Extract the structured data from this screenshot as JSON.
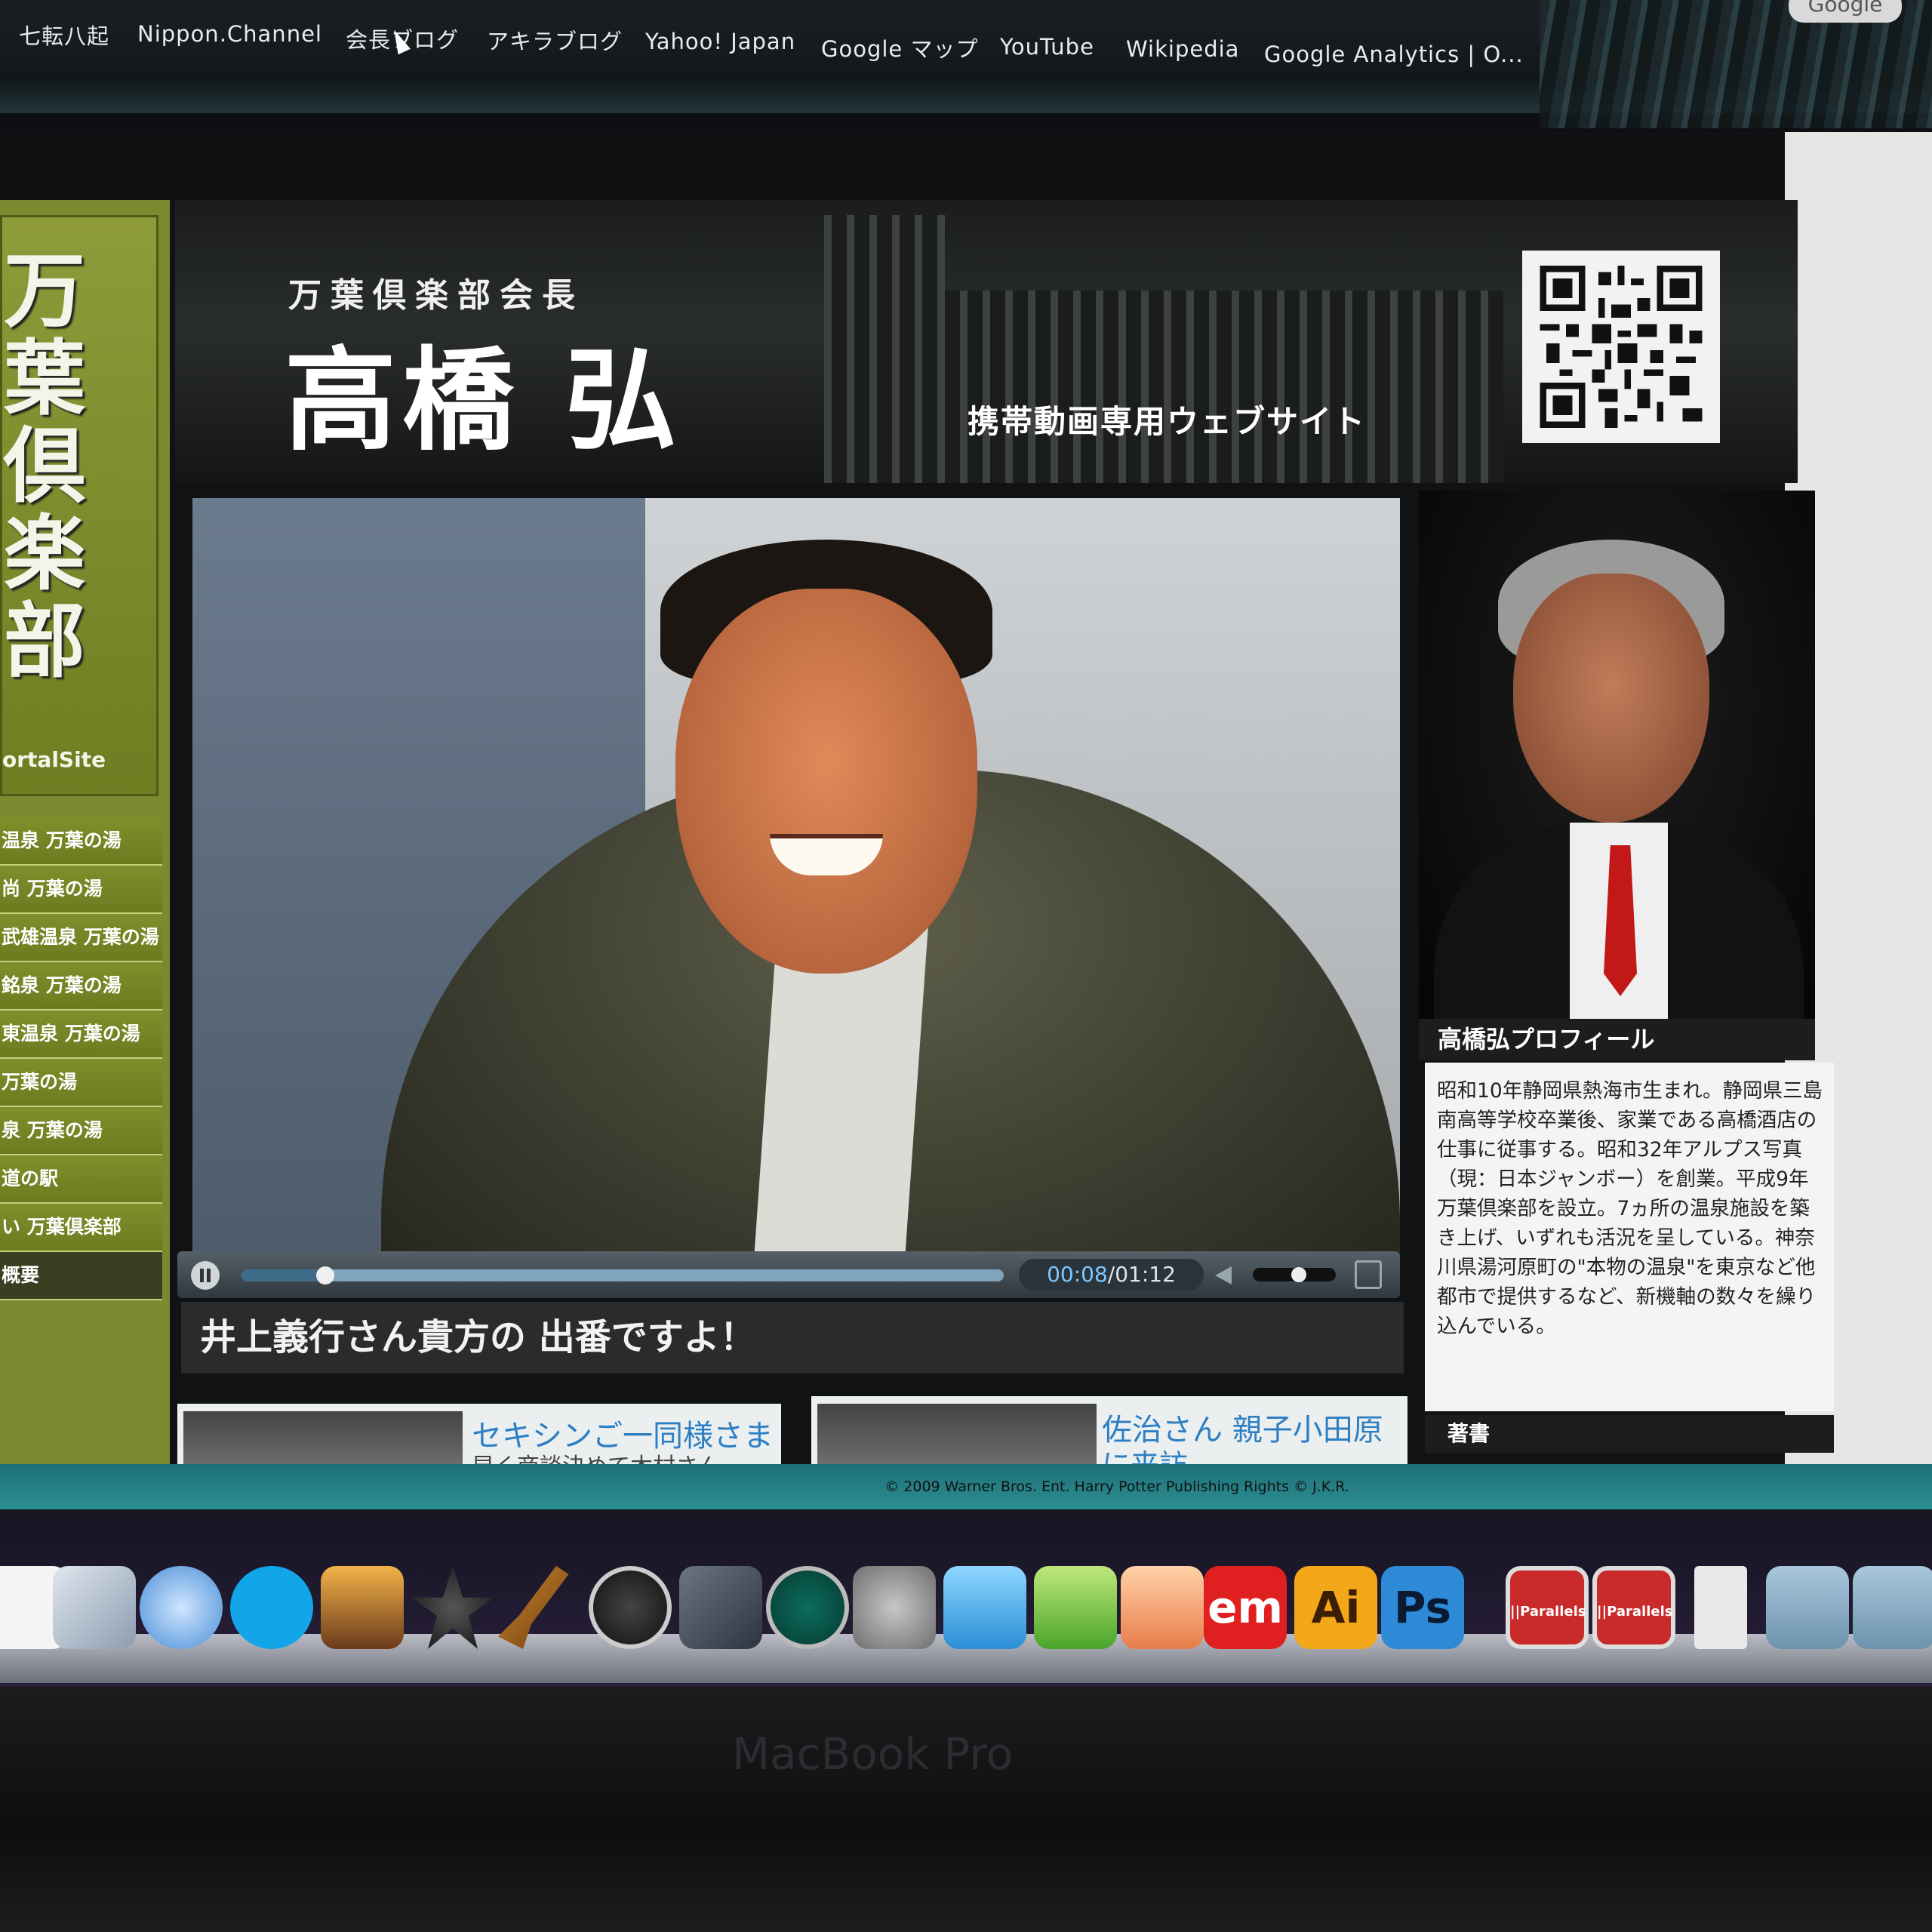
{
  "browser": {
    "bookmarks": [
      "七転八起",
      "Nippon.Channel",
      "会長ブログ",
      "アキラブログ",
      "Yahoo! Japan",
      "Google マップ",
      "YouTube",
      "Wikipedia",
      "Google Analytics | O..."
    ],
    "search_engine_label": "Google"
  },
  "sidebar": {
    "logo_text": "万葉倶楽部",
    "logo_sub": "ortalSite",
    "items": [
      "温泉 万葉の湯",
      "尚 万葉の湯",
      "武雄温泉 万葉の湯",
      "銘泉 万葉の湯",
      "東温泉 万葉の湯",
      "万葉の湯",
      "泉 万葉の湯",
      "道の駅",
      "い 万葉倶楽部",
      "概要"
    ]
  },
  "header": {
    "subtitle": "万葉倶楽部会長",
    "name": "高橋 弘",
    "tagline": "携帯動画専用ウェブサイト"
  },
  "video": {
    "time_current": "00:08",
    "time_total": "01:12",
    "time_separator": "/",
    "progress": 0.11,
    "volume": 0.55,
    "caption": "井上義行さん貴方の 出番ですよ！"
  },
  "thumbnails": [
    {
      "title": "セキシンご一同様さま",
      "sub": "早く商談決めて木村さん"
    },
    {
      "title": "佐治さん 親子小田原",
      "sub": "に来訪"
    }
  ],
  "profile": {
    "heading": "高橋弘プロフィール",
    "bio": "昭和10年静岡県熱海市生まれ。静岡県三島南高等学校卒業後、家業である高橋酒店の仕事に従事する。昭和32年アルプス写真（現：日本ジャンボー）を創業。平成9年万葉倶楽部を設立。7ヵ所の温泉施設を築き上げ、いずれも活況を呈している。神奈川県湯河原町の\"本物の温泉\"を東京など他都市で提供するなど、新機軸の数々を繰り込んでいる。",
    "books_heading": "著書"
  },
  "footer": {
    "copyright": "© 2009 Warner Bros. Ent. Harry Potter Publishing Rights © J.K.R."
  },
  "dock": {
    "em_label": "em",
    "ai_label": "Ai",
    "ps_label": "Ps",
    "parallels_label": "||Parallels"
  },
  "device": {
    "label": "MacBook Pro"
  },
  "colors": {
    "sidebar_green": "#7a8a2e",
    "link_blue": "#2d7fc4",
    "time_accent": "#7ec8ff",
    "tie_red": "#c21818"
  }
}
